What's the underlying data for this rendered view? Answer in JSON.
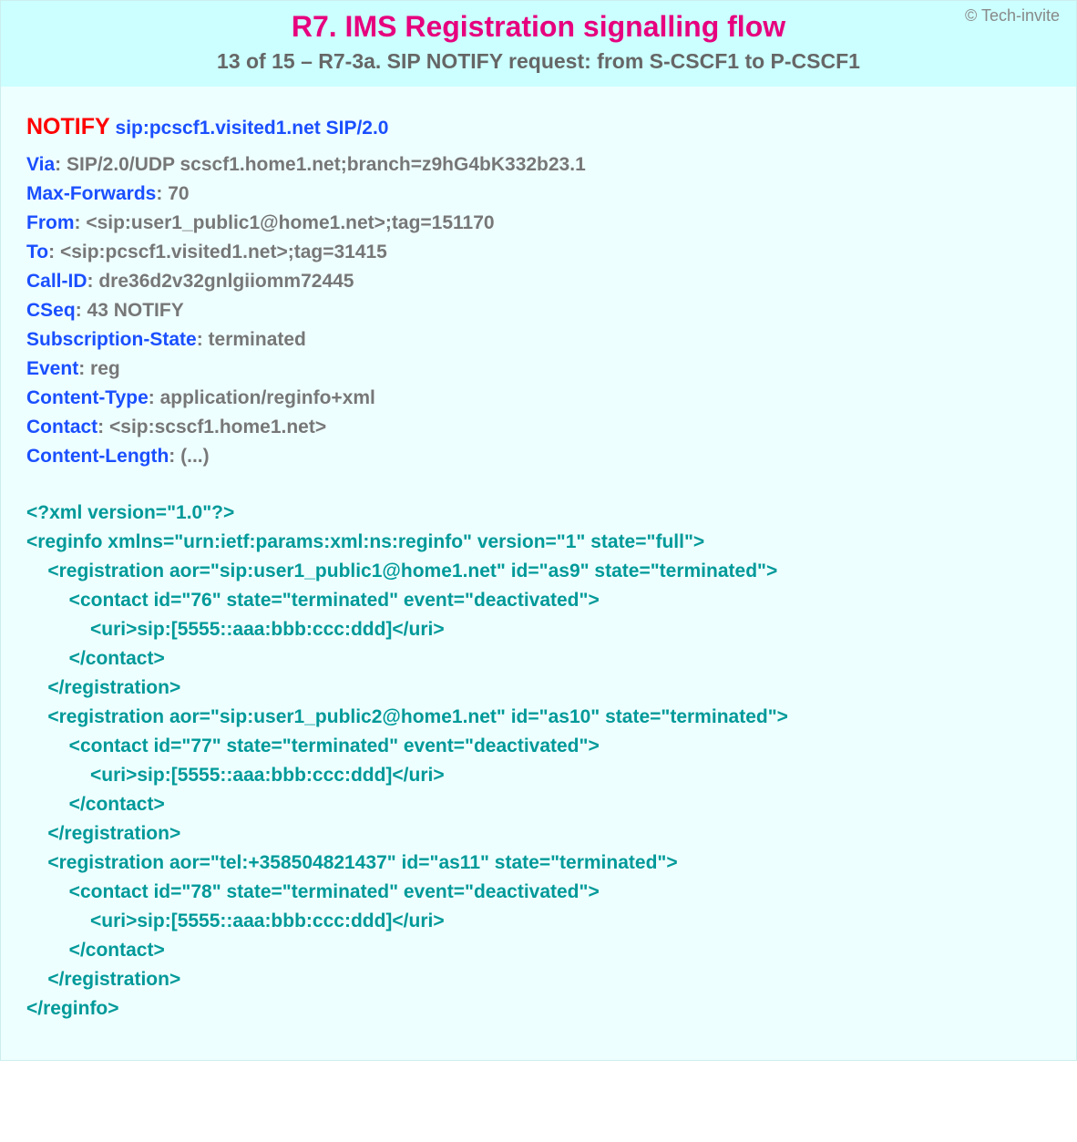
{
  "meta": {
    "copyright": "© Tech-invite",
    "title": "R7. IMS Registration signalling flow",
    "subtitle": "13 of 15 – R7-3a. SIP NOTIFY request: from S-CSCF1 to P-CSCF1"
  },
  "request": {
    "method": "NOTIFY",
    "uri": "sip:pcscf1.visited1.net SIP/2.0"
  },
  "headers": [
    {
      "name": "Via",
      "value": "SIP/2.0/UDP scscf1.home1.net;branch=z9hG4bK332b23.1"
    },
    {
      "name": "Max-Forwards",
      "value": "70"
    },
    {
      "name": "From",
      "value": "<sip:user1_public1@home1.net>;tag=151170"
    },
    {
      "name": "To",
      "value": "<sip:pcscf1.visited1.net>;tag=31415"
    },
    {
      "name": "Call-ID",
      "value": "dre36d2v32gnlgiiomm72445"
    },
    {
      "name": "CSeq",
      "value": "43 NOTIFY"
    },
    {
      "name": "Subscription-State",
      "value": "terminated"
    },
    {
      "name": "Event",
      "value": "reg"
    },
    {
      "name": "Content-Type",
      "value": "application/reginfo+xml"
    },
    {
      "name": "Contact",
      "value": "<sip:scscf1.home1.net>"
    },
    {
      "name": "Content-Length",
      "value": "(...)"
    }
  ],
  "xml_body": "<?xml version=\"1.0\"?>\n<reginfo xmlns=\"urn:ietf:params:xml:ns:reginfo\" version=\"1\" state=\"full\">\n    <registration aor=\"sip:user1_public1@home1.net\" id=\"as9\" state=\"terminated\">\n        <contact id=\"76\" state=\"terminated\" event=\"deactivated\">\n            <uri>sip:[5555::aaa:bbb:ccc:ddd]</uri>\n        </contact>\n    </registration>\n    <registration aor=\"sip:user1_public2@home1.net\" id=\"as10\" state=\"terminated\">\n        <contact id=\"77\" state=\"terminated\" event=\"deactivated\">\n            <uri>sip:[5555::aaa:bbb:ccc:ddd]</uri>\n        </contact>\n    </registration>\n    <registration aor=\"tel:+358504821437\" id=\"as11\" state=\"terminated\">\n        <contact id=\"78\" state=\"terminated\" event=\"deactivated\">\n            <uri>sip:[5555::aaa:bbb:ccc:ddd]</uri>\n        </contact>\n    </registration>\n</reginfo>"
}
